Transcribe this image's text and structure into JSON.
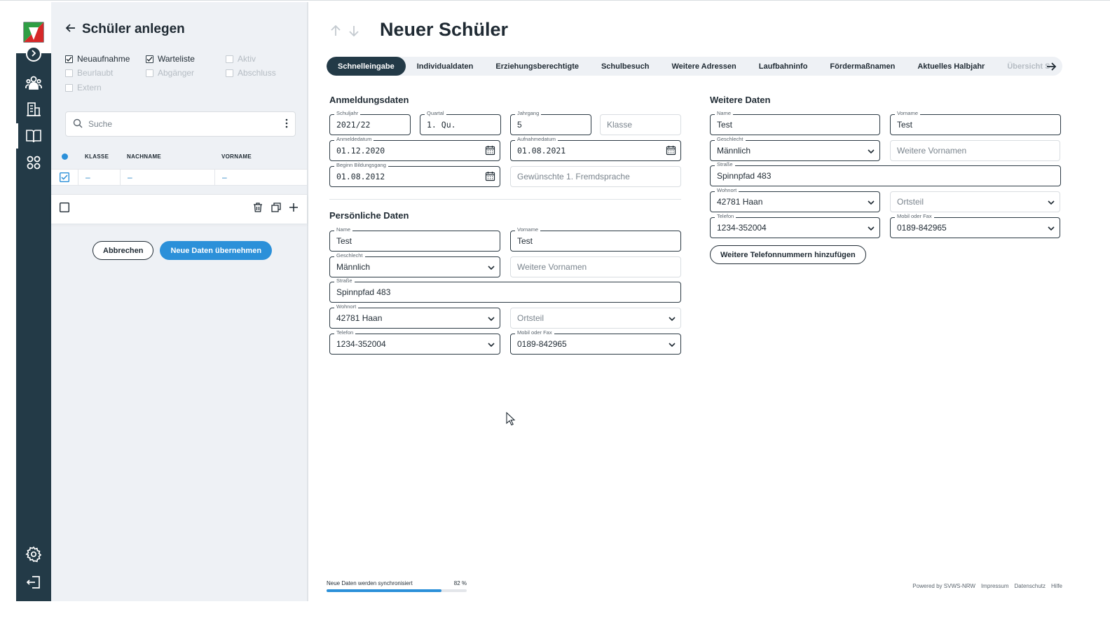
{
  "list_panel": {
    "title": "Schüler anlegen",
    "filters": {
      "neuaufnahme": "Neuaufnahme",
      "warteliste": "Warteliste",
      "aktiv": "Aktiv",
      "beurlaubt": "Beurlaubt",
      "abgaenger": "Abgänger",
      "abschluss": "Abschluss",
      "extern": "Extern"
    },
    "search_placeholder": "Suche",
    "table": {
      "headers": [
        "KLASSE",
        "NACHNAME",
        "VORNAME"
      ],
      "rows": [
        {
          "klasse": "–",
          "nachname": "–",
          "vorname": "–"
        }
      ]
    },
    "cancel_label": "Abbrechen",
    "submit_label": "Neue Daten übernehmen"
  },
  "main": {
    "title": "Neuer Schüler",
    "tabs": [
      "Schnelleingabe",
      "Individualdaten",
      "Erziehungsberechtigte",
      "Schulbesuch",
      "Weitere Adressen",
      "Laufbahninfo",
      "Fördermaßnamen",
      "Aktuelles Halbjahr",
      "Übersicht S"
    ],
    "anmeldung": {
      "title": "Anmeldungsdaten",
      "schuljahr_label": "Schuljahr",
      "schuljahr": "2021/22",
      "quartal_label": "Quartal",
      "quartal": "1. Qu.",
      "jahrgang_label": "Jahrgang",
      "jahrgang": "5",
      "klasse_placeholder": "Klasse",
      "anmeldedatum_label": "Anmeldedatum",
      "anmeldedatum": "01.12.2020",
      "aufnahmedatum_label": "Aufnahmedatum",
      "aufnahmedatum": "01.08.2021",
      "beginn_label": "Beginn Bildungsgang",
      "beginn": "01.08.2012",
      "fremdsprache_placeholder": "Gewünschte 1. Fremdsprache"
    },
    "persoenlich": {
      "title": "Persönliche Daten",
      "name_label": "Name",
      "name": "Test",
      "vorname_label": "Vorname",
      "vorname": "Test",
      "geschlecht_label": "Geschlecht",
      "geschlecht": "Männlich",
      "weitere_vornamen_placeholder": "Weitere Vornamen",
      "strasse_label": "Straße",
      "strasse": "Spinnpfad 483",
      "wohnort_label": "Wohnort",
      "wohnort": "42781 Haan",
      "ortsteil_placeholder": "Ortsteil",
      "telefon_label": "Telefon",
      "telefon": "1234-352004",
      "mobil_label": "Mobil oder Fax",
      "mobil": "0189-842965"
    },
    "weitere": {
      "title": "Weitere Daten",
      "name_label": "Name",
      "name": "Test",
      "vorname_label": "Vorname",
      "vorname": "Test",
      "geschlecht_label": "Geschlecht",
      "geschlecht": "Männlich",
      "weitere_vornamen_placeholder": "Weitere Vornamen",
      "strasse_label": "Straße",
      "strasse": "Spinnpfad 483",
      "wohnort_label": "Wohnort",
      "wohnort": "42781 Haan",
      "ortsteil_placeholder": "Ortsteil",
      "telefon_label": "Telefon",
      "telefon": "1234-352004",
      "mobil_label": "Mobil oder Fax",
      "mobil": "0189-842965",
      "add_phone_label": "Weitere Telefonnummern hinzufügen"
    }
  },
  "footer": {
    "sync_text": "Neue Daten werden synchronisiert",
    "sync_percent": "82 %",
    "sync_progress": 0.82,
    "powered": "Powered by SVWS-NRW",
    "impressum": "Impressum",
    "datenschutz": "Datenschutz",
    "hilfe": "Hilfe"
  },
  "colors": {
    "sidebar": "#233a47",
    "accent": "#2b90d9",
    "panel": "#eef1f5"
  }
}
